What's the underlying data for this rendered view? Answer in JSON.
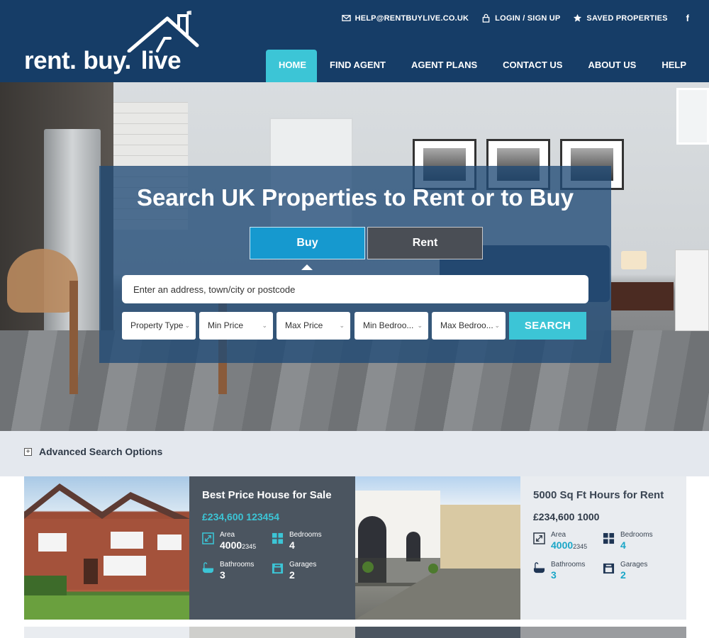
{
  "brand": {
    "logo_text_1": "rent.",
    "logo_text_2": "buy.",
    "logo_text_3": "live"
  },
  "toplinks": {
    "email": "HELP@RENTBUYLIVE.CO.UK",
    "login": "LOGIN / SIGN UP",
    "saved": "SAVED PROPERTIES",
    "facebook": "f"
  },
  "nav": [
    "HOME",
    "FIND AGENT",
    "AGENT PLANS",
    "CONTACT US",
    "ABOUT US",
    "HELP"
  ],
  "hero": {
    "title": "Search UK Properties to Rent or to Buy",
    "tab_buy": "Buy",
    "tab_rent": "Rent",
    "address_placeholder": "Enter an address, town/city or postcode",
    "filters": [
      "Property Type",
      "Min Price",
      "Max Price",
      "Min Bedroo...",
      "Max Bedroo..."
    ],
    "search_button": "SEARCH"
  },
  "advanced": {
    "plus": "+",
    "label": "Advanced Search Options"
  },
  "listings": [
    {
      "title": "Best Price House for Sale",
      "price": "£234,600 123454",
      "area_label": "Area",
      "area_value": "4000",
      "area_suffix": "2345",
      "bedrooms_label": "Bedrooms",
      "bedrooms_value": "4",
      "bathrooms_label": "Bathrooms",
      "bathrooms_value": "3",
      "garages_label": "Garages",
      "garages_value": "2"
    },
    {
      "title": "5000 Sq Ft Hours for Rent",
      "price": "£234,600 1000",
      "area_label": "Area",
      "area_value": "4000",
      "area_suffix": "2345",
      "bedrooms_label": "Bedrooms",
      "bedrooms_value": "4",
      "bathrooms_label": "Bathrooms",
      "bathrooms_value": "3",
      "garages_label": "Garages",
      "garages_value": "2"
    }
  ],
  "icons": {
    "email": "envelope-icon",
    "login": "lock-icon",
    "saved": "star-icon",
    "facebook": "facebook-icon",
    "area": "area-icon",
    "bedrooms": "bedroom-icon",
    "bathrooms": "bathtub-icon",
    "garages": "garage-icon",
    "dropdown": "chevron-down-icon",
    "expand": "plus-icon"
  },
  "colors": {
    "header_bg": "#163d67",
    "accent": "#3cc5d6",
    "buy_tab": "#1699cf",
    "rent_tab": "#4a4e55",
    "card_dark": "#4b5560",
    "card_light": "#e9ecf0"
  }
}
